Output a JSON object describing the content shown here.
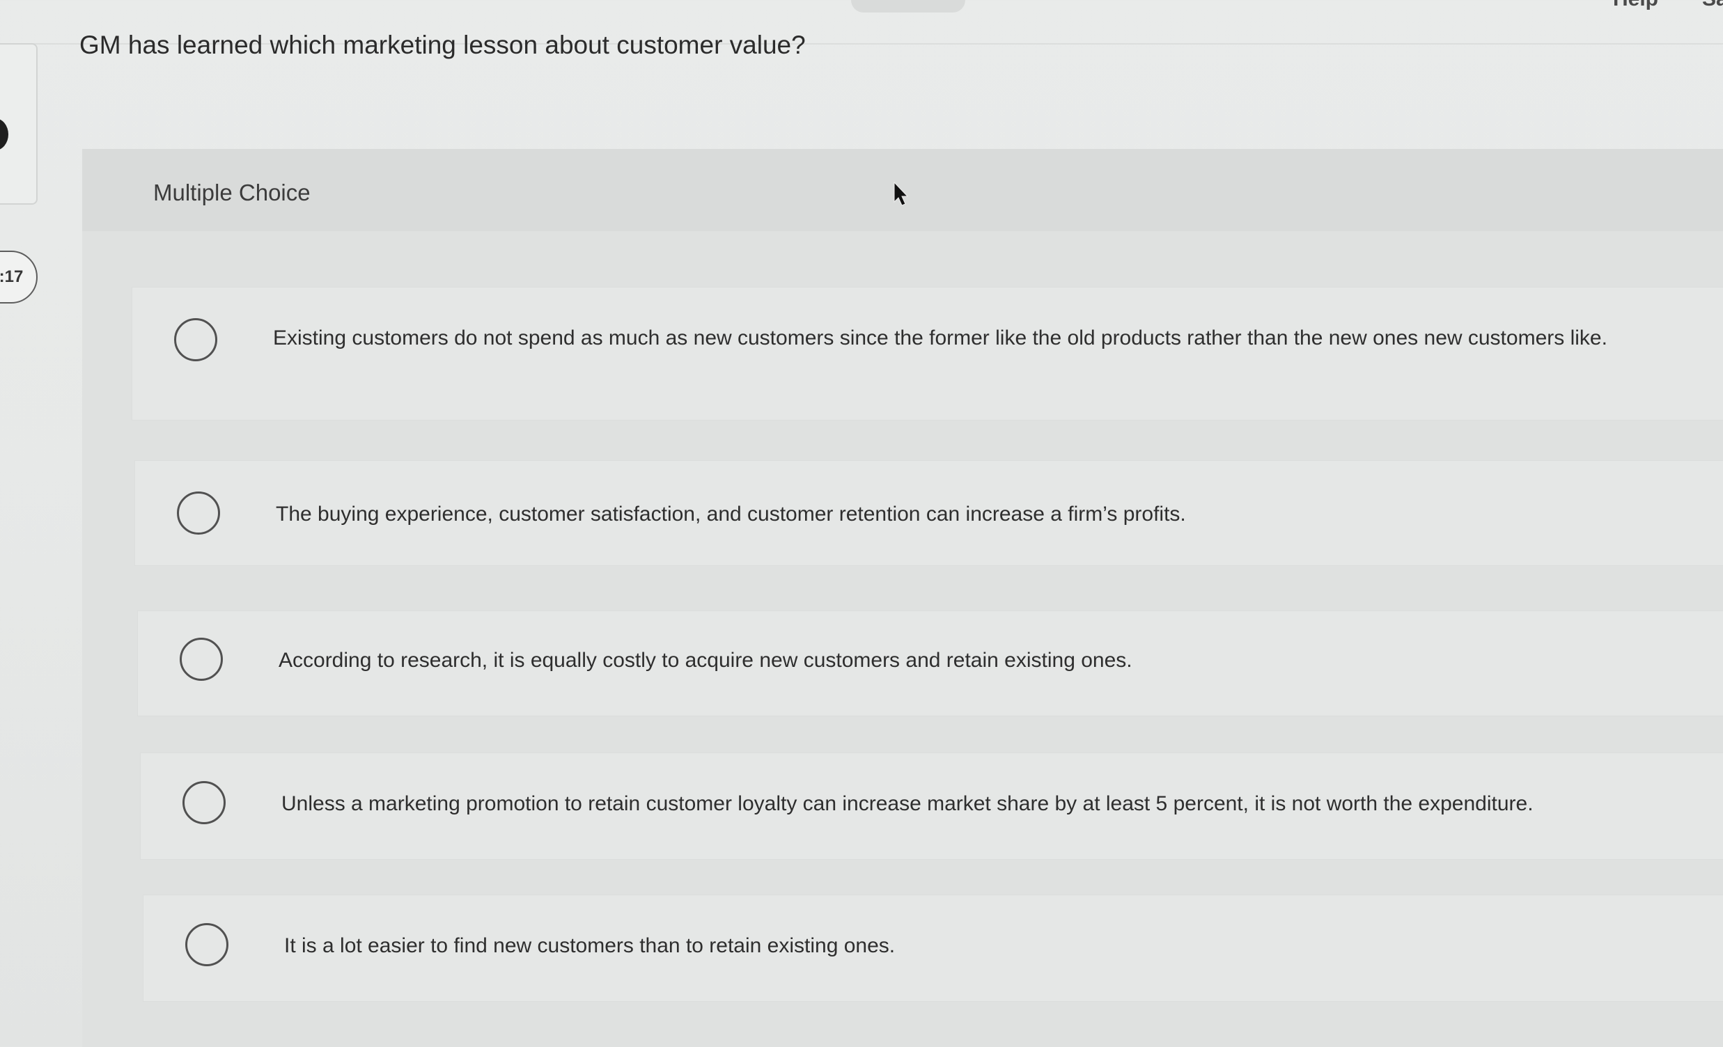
{
  "header": {
    "help_label": "Help",
    "save_label": "Sa"
  },
  "sidebar": {
    "timer": ":17"
  },
  "question": {
    "text": "GM has learned which marketing lesson about customer value?"
  },
  "panel": {
    "title": "Multiple Choice"
  },
  "options": [
    {
      "label": "Existing customers do not spend as much as new customers since the former like the old products rather than the new ones new customers like."
    },
    {
      "label": "The buying experience, customer satisfaction, and customer retention can increase a firm’s profits."
    },
    {
      "label": "According to research, it is equally costly to acquire new customers and retain existing ones."
    },
    {
      "label": "Unless a marketing promotion to retain customer loyalty can increase market share by at least 5 percent, it is not worth the expenditure."
    },
    {
      "label": "It is a lot easier to find new customers than to retain existing ones."
    }
  ]
}
